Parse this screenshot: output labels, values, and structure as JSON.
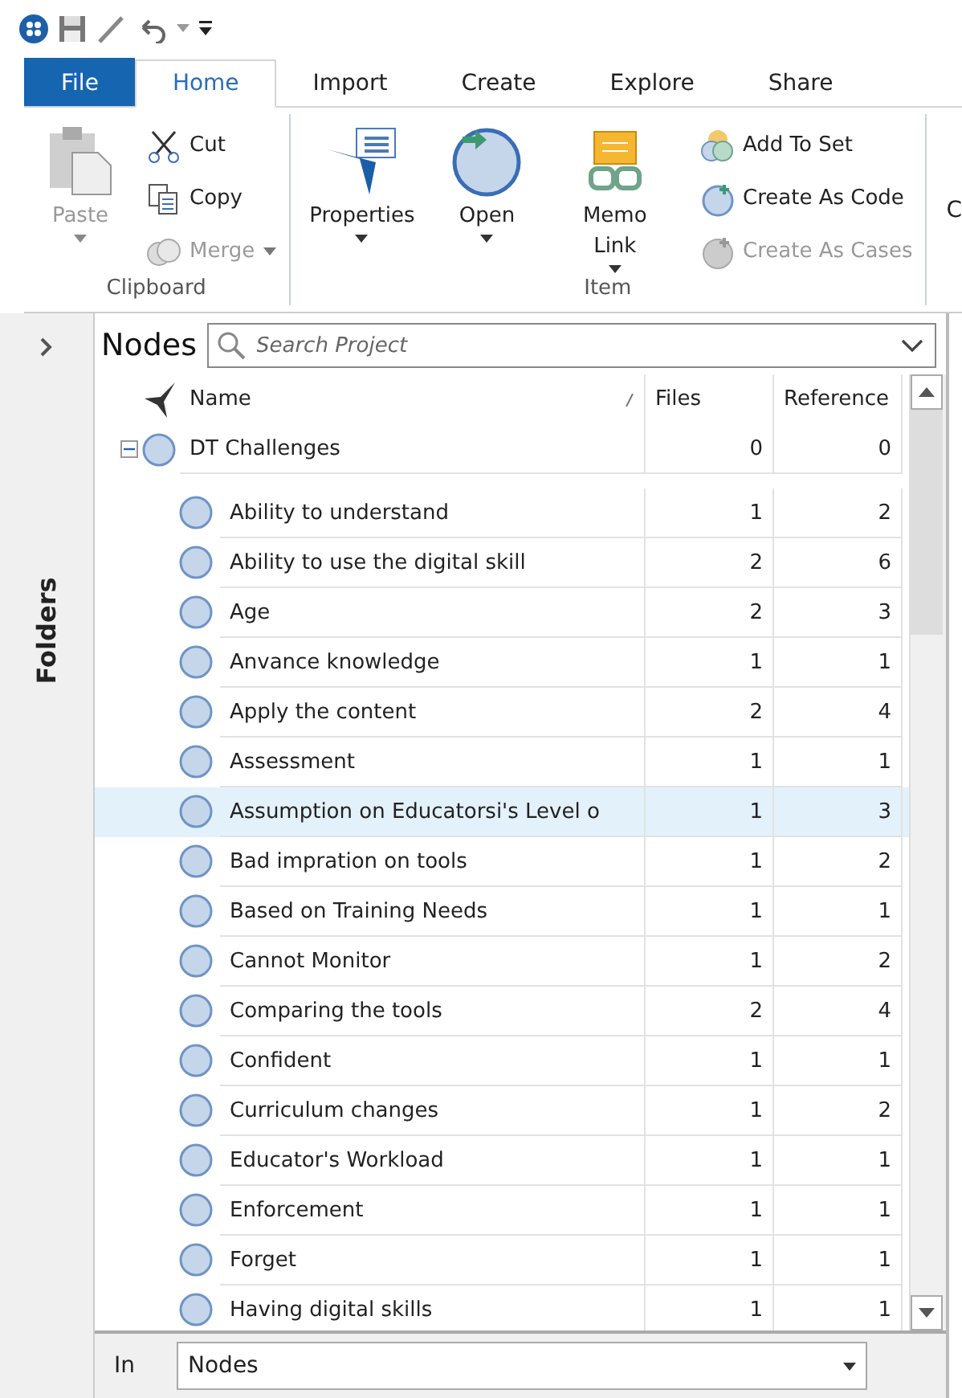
{
  "ribbon_tabs": [
    {
      "label": "File",
      "kind": "file",
      "selected": false
    },
    {
      "label": "Home",
      "kind": "tab",
      "selected": true
    },
    {
      "label": "Import",
      "kind": "tab",
      "selected": false
    },
    {
      "label": "Create",
      "kind": "tab",
      "selected": false
    },
    {
      "label": "Explore",
      "kind": "tab",
      "selected": false
    },
    {
      "label": "Share",
      "kind": "tab",
      "selected": false
    }
  ],
  "ribbon_groups": [
    {
      "label": "Clipboard",
      "large": [
        {
          "label": "Paste",
          "kind": "paste",
          "disabled": true,
          "dropdown": true
        }
      ],
      "small": [
        {
          "label": "Cut",
          "kind": "cut",
          "disabled": false,
          "dropdown": false
        },
        {
          "label": "Copy",
          "kind": "copy",
          "disabled": false,
          "dropdown": false
        },
        {
          "label": "Merge",
          "kind": "merge",
          "disabled": true,
          "dropdown": true
        }
      ]
    },
    {
      "label": "Item",
      "large": [
        {
          "label": "Properties",
          "kind": "properties",
          "disabled": false,
          "dropdown": true
        },
        {
          "label": "Open",
          "kind": "open",
          "disabled": false,
          "dropdown": true
        },
        {
          "label": "Memo Link",
          "kind": "memo",
          "disabled": false,
          "dropdown": true
        }
      ],
      "small": [
        {
          "label": "Add To Set",
          "kind": "set",
          "disabled": false,
          "dropdown": false
        },
        {
          "label": "Create As Code",
          "kind": "code",
          "disabled": false,
          "dropdown": false
        },
        {
          "label": "Create As Cases",
          "kind": "cases",
          "disabled": true,
          "dropdown": false
        }
      ]
    }
  ],
  "ribbon_partial_label": "C",
  "sidebar": {
    "title": "Folders"
  },
  "panel": {
    "title": "Nodes",
    "search": {
      "placeholder": "Search Project"
    }
  },
  "table": {
    "columns": [
      "Name",
      "Files",
      "Reference"
    ],
    "root": {
      "name": "DT Challenges",
      "files": "0",
      "reference": "0",
      "expanded": true,
      "children": [
        {
          "name": "Ability to understand",
          "files": "1",
          "reference": "2",
          "selected": false
        },
        {
          "name": "Ability to use the digital skill",
          "files": "2",
          "reference": "6",
          "selected": false
        },
        {
          "name": "Age",
          "files": "2",
          "reference": "3",
          "selected": false
        },
        {
          "name": "Anvance knowledge",
          "files": "1",
          "reference": "1",
          "selected": false
        },
        {
          "name": "Apply the content",
          "files": "2",
          "reference": "4",
          "selected": false
        },
        {
          "name": "Assessment",
          "files": "1",
          "reference": "1",
          "selected": false
        },
        {
          "name": "Assumption on Educatorsi's Level o",
          "files": "1",
          "reference": "3",
          "selected": true
        },
        {
          "name": "Bad impration on tools",
          "files": "1",
          "reference": "2",
          "selected": false
        },
        {
          "name": "Based on Training Needs",
          "files": "1",
          "reference": "1",
          "selected": false
        },
        {
          "name": "Cannot Monitor",
          "files": "1",
          "reference": "2",
          "selected": false
        },
        {
          "name": "Comparing the tools",
          "files": "2",
          "reference": "4",
          "selected": false
        },
        {
          "name": "Confident",
          "files": "1",
          "reference": "1",
          "selected": false
        },
        {
          "name": "Curriculum changes",
          "files": "1",
          "reference": "2",
          "selected": false
        },
        {
          "name": "Educator's Workload",
          "files": "1",
          "reference": "1",
          "selected": false
        },
        {
          "name": "Enforcement",
          "files": "1",
          "reference": "1",
          "selected": false
        },
        {
          "name": "Forget",
          "files": "1",
          "reference": "1",
          "selected": false
        },
        {
          "name": "Having digital skills",
          "files": "1",
          "reference": "1",
          "selected": false
        }
      ]
    }
  },
  "footer": {
    "label": "In",
    "value": "Nodes"
  }
}
